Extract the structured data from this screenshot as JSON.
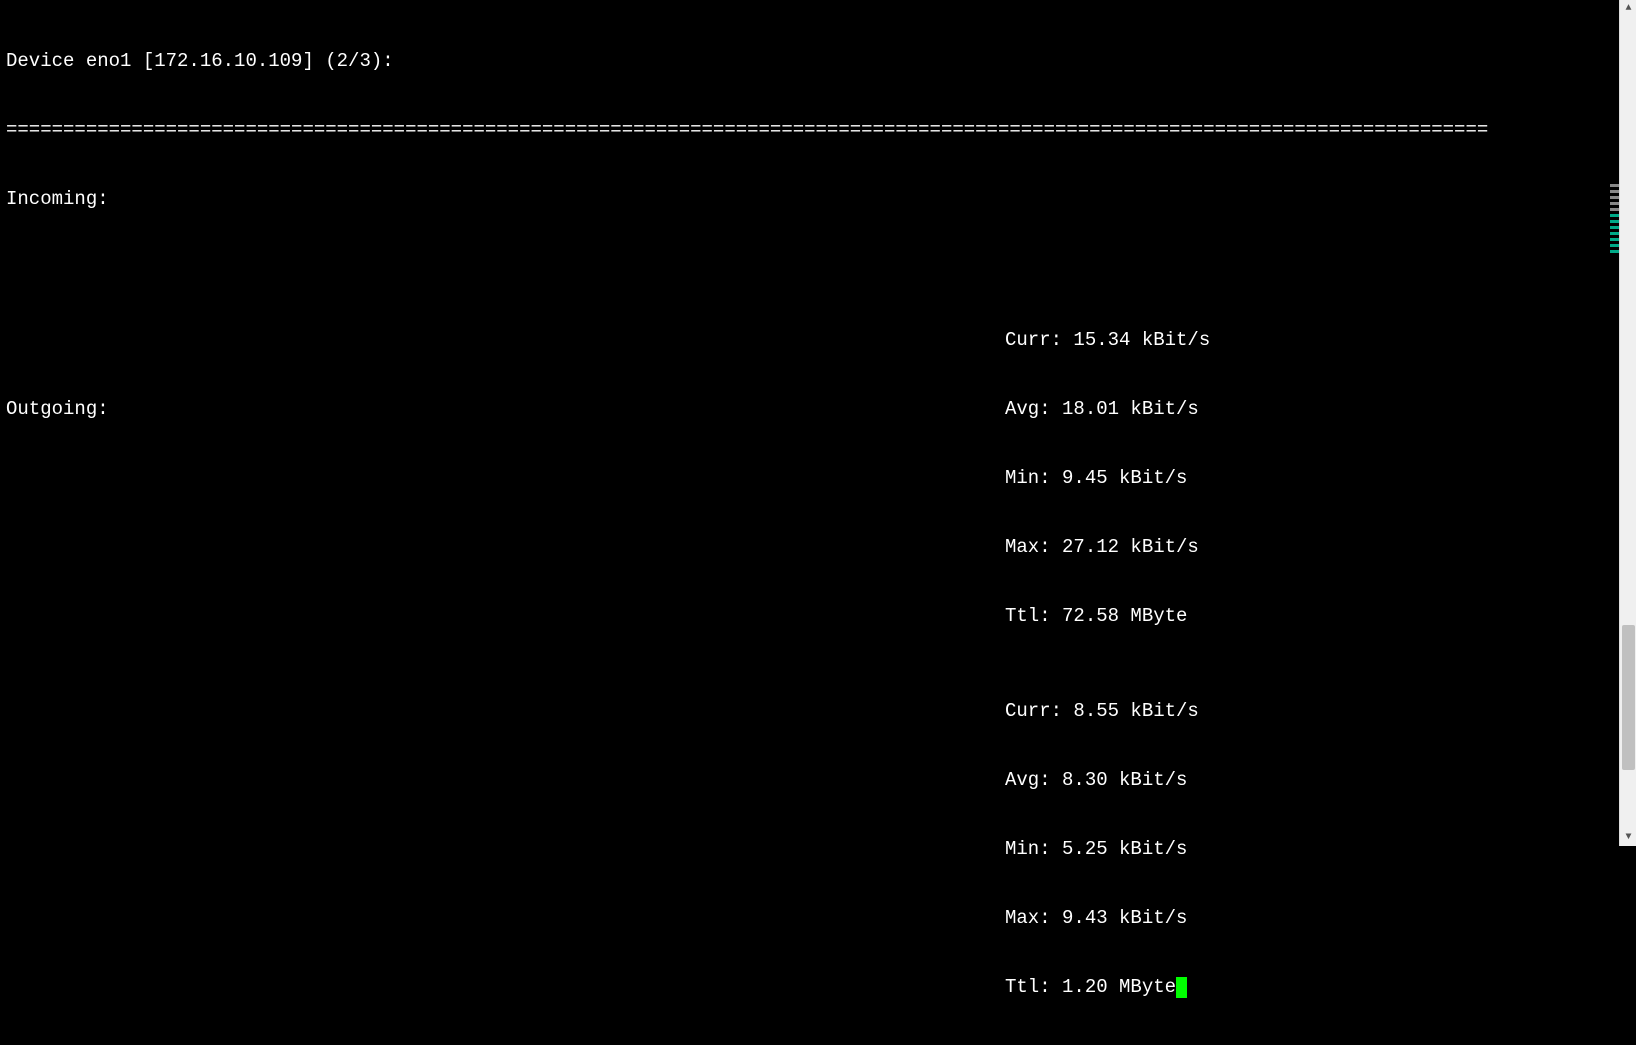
{
  "header": {
    "device_line": "Device eno1 [172.16.10.109] (2/3):",
    "separator": "==============================================================================================================================================================================================================================================================================",
    "incoming_label": "Incoming:",
    "outgoing_label": "Outgoing:"
  },
  "incoming": {
    "curr": "Curr: 15.34 kBit/s",
    "avg": "Avg: 18.01 kBit/s",
    "min": "Min: 9.45 kBit/s",
    "max": "Max: 27.12 kBit/s",
    "ttl": "Ttl: 72.58 MByte"
  },
  "outgoing": {
    "curr": "Curr: 8.55 kBit/s",
    "avg": "Avg: 8.30 kBit/s",
    "min": "Min: 5.25 kBit/s",
    "max": "Max: 9.43 kBit/s",
    "ttl": "Ttl: 1.20 MByte"
  }
}
